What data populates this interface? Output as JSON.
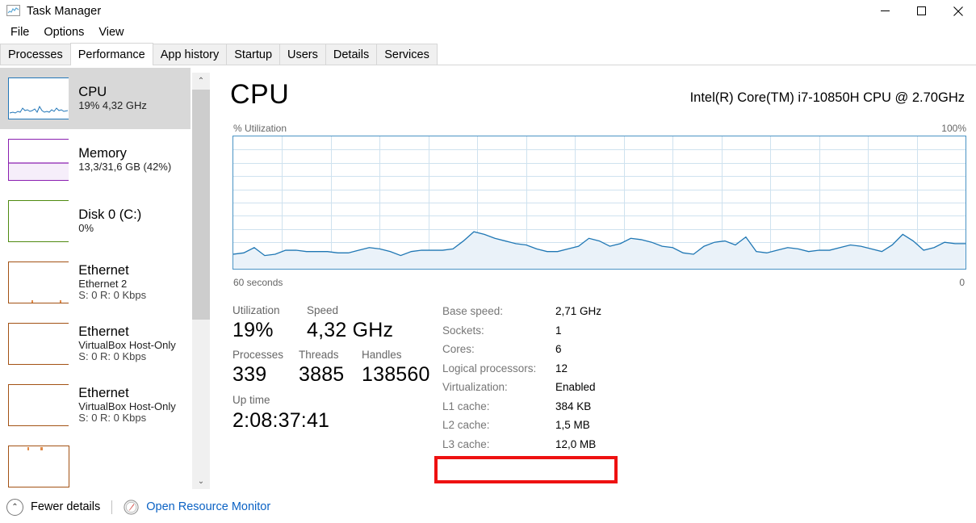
{
  "window": {
    "title": "Task Manager",
    "icon": "task-manager-icon",
    "controls": {
      "minimize": "—",
      "maximize": "□",
      "close": "✕"
    }
  },
  "menu": {
    "items": [
      "File",
      "Options",
      "View"
    ]
  },
  "tabs": {
    "items": [
      "Processes",
      "Performance",
      "App history",
      "Startup",
      "Users",
      "Details",
      "Services"
    ],
    "active": "Performance"
  },
  "sidebar": {
    "items": [
      {
        "name": "CPU",
        "sub": "19%  4,32 GHz",
        "sub2": "",
        "color": "#2176b8",
        "selected": true
      },
      {
        "name": "Memory",
        "sub": "13,3/31,6 GB (42%)",
        "sub2": "",
        "color": "#8a1fb0",
        "selected": false
      },
      {
        "name": "Disk 0 (C:)",
        "sub": "0%",
        "sub2": "",
        "color": "#4f8a10",
        "selected": false
      },
      {
        "name": "Ethernet",
        "sub": "Ethernet 2",
        "sub2": "S: 0 R: 0 Kbps",
        "color": "#a35214",
        "selected": false
      },
      {
        "name": "Ethernet",
        "sub": "VirtualBox Host-Only",
        "sub2": "S: 0 R: 0 Kbps",
        "color": "#a35214",
        "selected": false
      },
      {
        "name": "Ethernet",
        "sub": "VirtualBox Host-Only",
        "sub2": "S: 0 R: 0 Kbps",
        "color": "#a35214",
        "selected": false
      }
    ],
    "scroll": {
      "up": "⌃",
      "down": "⌄"
    }
  },
  "main": {
    "heading": "CPU",
    "model": "Intel(R) Core(TM) i7-10850H CPU @ 2.70GHz",
    "graph": {
      "top_left_label": "% Utilization",
      "top_right_label": "100%",
      "bottom_left_label": "60 seconds",
      "bottom_right_label": "0",
      "line_color": "#1f77b4",
      "fill_color": "#eaf2f9",
      "grid_color": "#cfe2ef",
      "border_color": "#4a93c4"
    },
    "stats_left": [
      {
        "label": "Utilization",
        "value": "19%"
      },
      {
        "label": "Speed",
        "value": "4,32 GHz"
      },
      {
        "label": "Processes",
        "value": "339"
      },
      {
        "label": "Threads",
        "value": "3885"
      },
      {
        "label": "Handles",
        "value": "138560"
      },
      {
        "label": "Up time",
        "value": "2:08:37:41"
      }
    ],
    "stats_right": [
      {
        "label": "Base speed:",
        "value": "2,71 GHz"
      },
      {
        "label": "Sockets:",
        "value": "1"
      },
      {
        "label": "Cores:",
        "value": "6"
      },
      {
        "label": "Logical processors:",
        "value": "12"
      },
      {
        "label": "Virtualization:",
        "value": "Enabled"
      },
      {
        "label": "L1 cache:",
        "value": "384 KB"
      },
      {
        "label": "L2 cache:",
        "value": "1,5 MB"
      },
      {
        "label": "L3 cache:",
        "value": "12,0 MB"
      }
    ],
    "highlight_color": "#ee1111"
  },
  "bottom": {
    "fewer_details": "Fewer details",
    "chevron": "⌃",
    "resource_monitor": "Open Resource Monitor",
    "resource_monitor_icon": "resource-monitor-icon",
    "link_color": "#0b62c4"
  },
  "chart_data": {
    "type": "area",
    "title": "% Utilization",
    "xlabel": "60 seconds",
    "ylabel": "% Utilization",
    "ylim": [
      0,
      100
    ],
    "xlim": [
      60,
      0
    ],
    "grid": true,
    "series": [
      {
        "name": "CPU Utilization",
        "values": [
          11,
          12,
          16,
          10,
          11,
          14,
          14,
          13,
          13,
          13,
          12,
          12,
          14,
          16,
          15,
          13,
          10,
          13,
          14,
          14,
          14,
          15,
          21,
          28,
          26,
          23,
          21,
          19,
          18,
          15,
          13,
          13,
          15,
          17,
          23,
          21,
          17,
          19,
          23,
          22,
          20,
          17,
          16,
          12,
          11,
          17,
          20,
          21,
          18,
          24,
          13,
          12,
          14,
          16,
          15,
          13,
          14,
          14,
          16,
          18,
          17,
          15,
          13,
          18,
          26,
          21,
          14,
          16,
          20,
          19,
          19
        ]
      }
    ]
  }
}
